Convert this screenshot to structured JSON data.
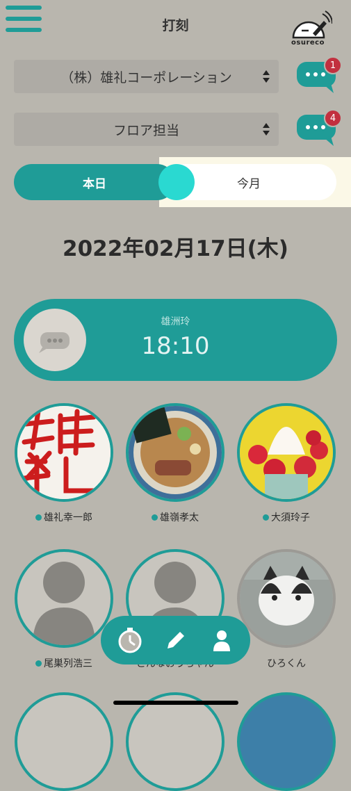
{
  "header": {
    "title": "打刻",
    "logo_text": "osureco"
  },
  "selects": {
    "company": "（株）雄礼コーポレーション",
    "role": "フロア担当"
  },
  "chat_badges": {
    "company": "1",
    "role": "4"
  },
  "tabs": {
    "today": "本日",
    "month": "今月"
  },
  "date": "2022年02月17日(木)",
  "current_punch": {
    "name": "雄洲玲",
    "time": "18:10"
  },
  "members": [
    {
      "name": "雄礼幸一郎",
      "online": true
    },
    {
      "name": "雄嶺孝太",
      "online": true
    },
    {
      "name": "大須玲子",
      "online": true
    },
    {
      "name": "尾巣列浩三",
      "online": true
    },
    {
      "name": "どんなおうちゃん",
      "online": false
    },
    {
      "name": "ひろくん",
      "online": false
    }
  ],
  "nav": [
    "stopwatch-icon",
    "pencil-icon",
    "person-icon"
  ],
  "colors": {
    "accent": "#1f9c97",
    "background": "#b9b6ae",
    "badge": "#c2303f"
  }
}
